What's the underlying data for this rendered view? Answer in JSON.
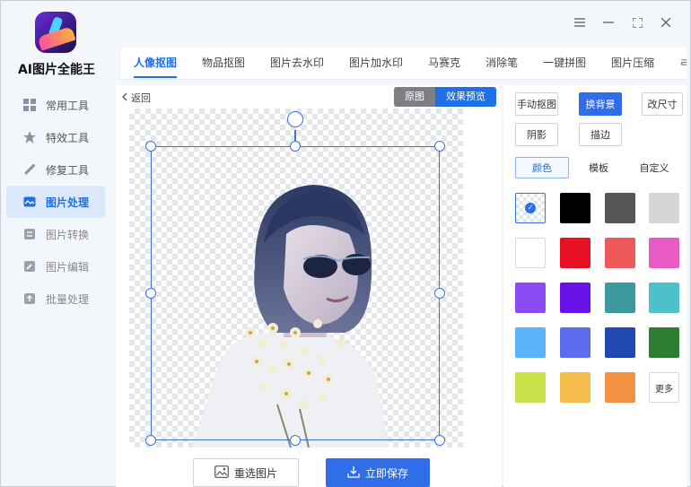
{
  "app": {
    "name": "AI图片全能王"
  },
  "sidebar": {
    "items": [
      {
        "label": "常用工具",
        "icon": "grid-icon"
      },
      {
        "label": "特效工具",
        "icon": "star-icon"
      },
      {
        "label": "修复工具",
        "icon": "wand-icon"
      },
      {
        "label": "图片处理",
        "icon": "image-wave-icon",
        "active": true
      },
      {
        "label": "图片转换",
        "icon": "convert-icon"
      },
      {
        "label": "图片编辑",
        "icon": "edit-icon"
      },
      {
        "label": "批量处理",
        "icon": "upload-icon"
      }
    ]
  },
  "tabs": [
    {
      "label": "人像抠图",
      "active": true
    },
    {
      "label": "物品抠图"
    },
    {
      "label": "图片去水印"
    },
    {
      "label": "图片加水印"
    },
    {
      "label": "马赛克"
    },
    {
      "label": "消除笔"
    },
    {
      "label": "一键拼图"
    },
    {
      "label": "图片压缩"
    },
    {
      "label": "ㄹ"
    }
  ],
  "editor": {
    "back_label": "返回",
    "view_original": "原图",
    "view_effect": "效果预览",
    "reselect_label": "重选图片",
    "save_label": "立即保存"
  },
  "panel": {
    "manual_cutout": "手动抠图",
    "change_bg": "换背景",
    "resize": "改尺寸",
    "shadow": "阴影",
    "stroke": "描边",
    "subtabs": [
      "颜色",
      "模板",
      "自定义"
    ],
    "more_label": "更多",
    "swatches": [
      "transparent",
      "#000000",
      "#555555",
      "#d6d6d6",
      "#ffffff",
      "#e81123",
      "#ee5a5a",
      "#e85cc4",
      "#8a4cf2",
      "#6a10e8",
      "#3a9aa0",
      "#4ec0c9",
      "#5ab4f8",
      "#5d6df0",
      "#1f48b0",
      "#2e7d32",
      "#c9e24a",
      "#f4bc4a",
      "#f39242"
    ]
  },
  "colors": {
    "accent": "#1f6fe5",
    "primary_button": "#2f6ee8",
    "selection": "#3b73d9"
  }
}
